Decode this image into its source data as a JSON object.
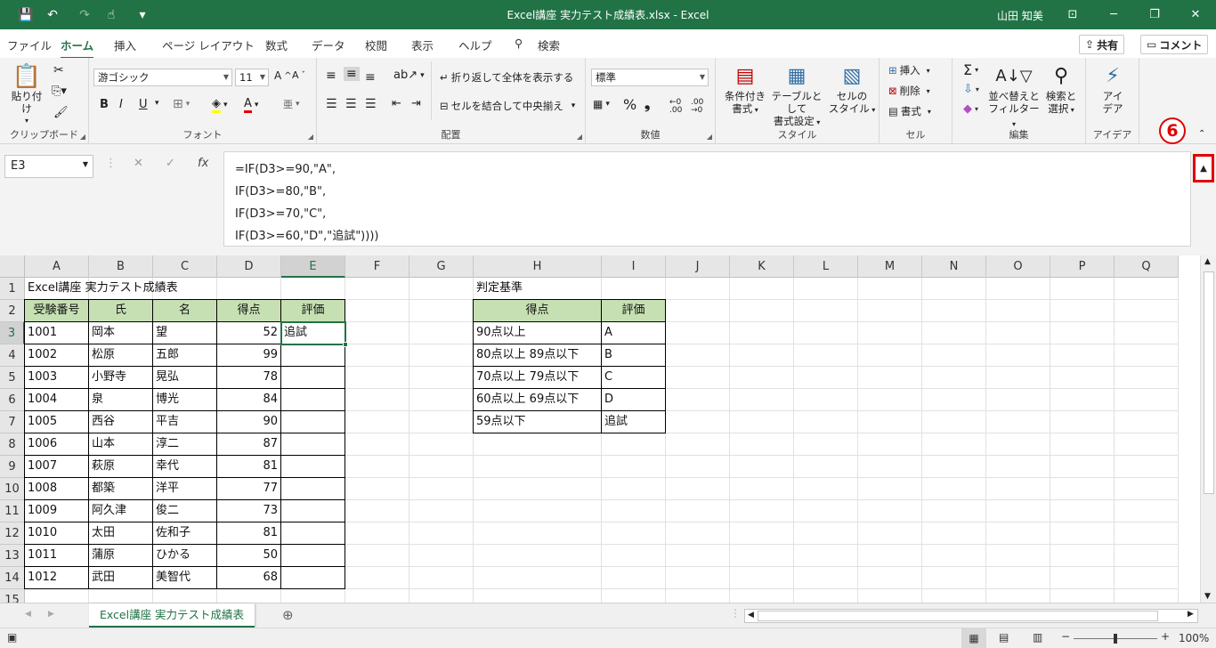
{
  "title": {
    "text": "Excel講座 実力テスト成績表.xlsx  -  Excel",
    "user": "山田 知美"
  },
  "quick_access": {
    "save": "💾",
    "undo": "↶",
    "redo": "↷",
    "touch": "☝",
    "more": "▾"
  },
  "tabs": [
    "ファイル",
    "ホーム",
    "挿入",
    "ページ レイアウト",
    "数式",
    "データ",
    "校閲",
    "表示",
    "ヘルプ",
    "検索"
  ],
  "share": {
    "share_label": "共有",
    "comment_label": "コメント"
  },
  "ribbon": {
    "clipboard": {
      "label": "クリップボード",
      "paste": "貼り付け"
    },
    "font": {
      "label": "フォント",
      "name": "游ゴシック",
      "size": "11",
      "bold": "B",
      "italic": "I",
      "underline": "U"
    },
    "alignment": {
      "label": "配置",
      "wrap": "折り返して全体を表示する",
      "merge": "セルを結合して中央揃え"
    },
    "number": {
      "label": "数値",
      "format": "標準"
    },
    "styles": {
      "label": "スタイル",
      "conditional": [
        "条件付き",
        "書式"
      ],
      "table": [
        "テーブルとして",
        "書式設定"
      ],
      "cell": [
        "セルの",
        "スタイル"
      ]
    },
    "cells": {
      "label": "セル",
      "insert": "挿入",
      "delete": "削除",
      "format": "書式"
    },
    "editing": {
      "label": "編集",
      "sort": [
        "並べ替えと",
        "フィルター"
      ],
      "find": [
        "検索と",
        "選択"
      ]
    },
    "ideas": {
      "label": "アイデア",
      "btn": [
        "アイ",
        "デア"
      ]
    }
  },
  "formula": {
    "namebox": "E3",
    "lines": [
      "=IF(D3>=90,\"A\",",
      "IF(D3>=80,\"B\",",
      "IF(D3>=70,\"C\",",
      "IF(D3>=60,\"D\",\"追試\"))))"
    ],
    "callout": "6"
  },
  "columns": [
    "A",
    "B",
    "C",
    "D",
    "E",
    "F",
    "G",
    "H",
    "I",
    "J",
    "K",
    "L",
    "M",
    "N",
    "O",
    "P",
    "Q"
  ],
  "rows": [
    "1",
    "2",
    "3",
    "4",
    "5",
    "6",
    "7",
    "8",
    "9",
    "10",
    "11",
    "12",
    "13",
    "14",
    "15"
  ],
  "sheet": {
    "title": "Excel講座 実力テスト成績表",
    "headers": [
      "受験番号",
      "氏",
      "名",
      "得点",
      "評価"
    ],
    "data": [
      [
        "1001",
        "岡本",
        "望",
        "52",
        "追試"
      ],
      [
        "1002",
        "松原",
        "五郎",
        "99",
        ""
      ],
      [
        "1003",
        "小野寺",
        "晃弘",
        "78",
        ""
      ],
      [
        "1004",
        "泉",
        "博光",
        "84",
        ""
      ],
      [
        "1005",
        "西谷",
        "平吉",
        "90",
        ""
      ],
      [
        "1006",
        "山本",
        "淳二",
        "87",
        ""
      ],
      [
        "1007",
        "萩原",
        "幸代",
        "81",
        ""
      ],
      [
        "1008",
        "都築",
        "洋平",
        "77",
        ""
      ],
      [
        "1009",
        "阿久津",
        "俊二",
        "73",
        ""
      ],
      [
        "1010",
        "太田",
        "佐和子",
        "81",
        ""
      ],
      [
        "1011",
        "蒲原",
        "ひかる",
        "50",
        ""
      ],
      [
        "1012",
        "武田",
        "美智代",
        "68",
        ""
      ]
    ],
    "criteria_title": "判定基準",
    "criteria_headers": [
      "得点",
      "評価"
    ],
    "criteria": [
      [
        "90点以上",
        "A"
      ],
      [
        "80点以上 89点以下",
        "B"
      ],
      [
        "70点以上 79点以下",
        "C"
      ],
      [
        "60点以上 69点以下",
        "D"
      ],
      [
        "59点以下",
        "追試"
      ]
    ]
  },
  "sheet_tab": "Excel講座 実力テスト成績表",
  "status": {
    "zoom": "100%"
  }
}
